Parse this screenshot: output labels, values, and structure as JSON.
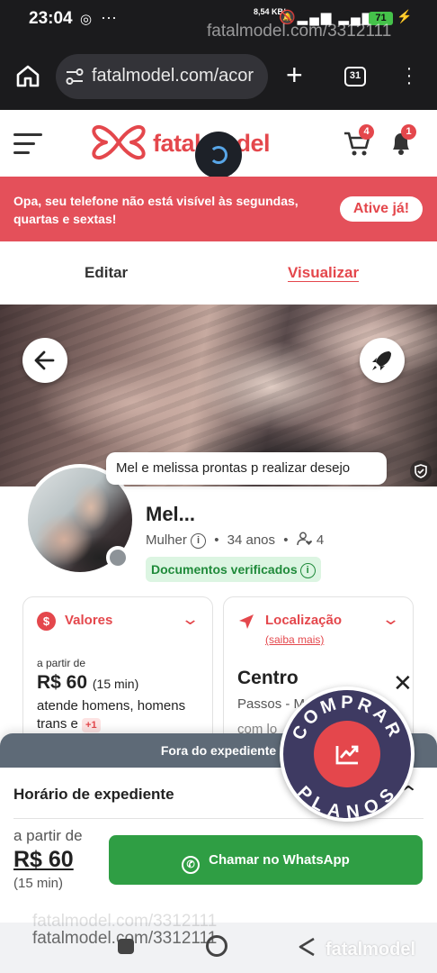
{
  "status_bar": {
    "time": "23:04",
    "network_speed": "8,54 KB/s",
    "battery": "71",
    "watermark": "fatalmodel.com/3312111"
  },
  "browser": {
    "url": "fatalmodel.com/acor",
    "tab_count": "31"
  },
  "header": {
    "logo_text": "fatalmodel",
    "cart_badge": "4",
    "notifications_badge": "1"
  },
  "alert": {
    "message": "Opa, seu telefone não está visível às segundas, quartas e sextas!",
    "action_label": "Ative já!"
  },
  "tabs": {
    "edit_label": "Editar",
    "view_label": "Visualizar"
  },
  "profile": {
    "bio": "Mel e melissa prontas p realizar desejo",
    "name": "Mel...",
    "gender": "Mulher",
    "age": "34 anos",
    "companions": "4",
    "verified_label": "Documentos verificados"
  },
  "values_card": {
    "title": "Valores",
    "from_label": "a partir de",
    "price": "R$ 60",
    "duration": "(15 min)",
    "serves": "atende homens, homens trans e",
    "more_badge": "+1"
  },
  "location_card": {
    "title": "Localização",
    "more_link": "(saiba mais)",
    "city": "Centro",
    "region": "Passos - M",
    "extra": "com lo"
  },
  "sheet": {
    "status_banner": "Fora do expediente",
    "hours_label": "Horário de expediente",
    "from_label": "a partir de",
    "price": "R$ 60",
    "duration": "(15 min)",
    "whatsapp_label": "Chamar no WhatsApp"
  },
  "plans_badge": {
    "top_text": "COMPRAR",
    "bottom_text": "PLANOS"
  },
  "footer_watermark": {
    "url": "fatalmodel.com/3312111",
    "logo_text": "fatalmodel"
  },
  "colors": {
    "brand": "#e4474c",
    "whatsapp": "#2f9e44",
    "verified_bg": "#dcf5e2",
    "plans_badge": "#3e3a62",
    "sheet_header": "#5e6a77"
  },
  "icons": [
    "whatsapp-icon",
    "home-icon",
    "site-info-icon",
    "new-tab-icon",
    "tabs-icon",
    "menu-dots-icon",
    "hamburger-icon",
    "cart-icon",
    "bell-icon",
    "arrow-left-icon",
    "rocket-icon",
    "shield-check-icon",
    "info-icon",
    "user-heart-icon",
    "dollar-icon",
    "navigation-icon",
    "chevron-down-icon",
    "chevron-up-icon",
    "close-icon",
    "chart-icon"
  ]
}
